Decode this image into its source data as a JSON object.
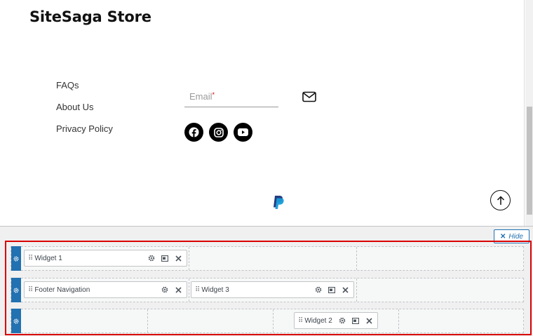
{
  "site": {
    "title": "SiteSaga Store"
  },
  "footer_nav": {
    "links": [
      "FAQs",
      "About Us",
      "Privacy Policy"
    ]
  },
  "newsletter": {
    "email_placeholder": "Email",
    "required_mark": "*"
  },
  "social": {
    "icons": [
      "facebook-icon",
      "instagram-icon",
      "youtube-icon"
    ]
  },
  "builder": {
    "hide_label": "Hide",
    "rows": [
      {
        "widgets": [
          "Widget 1"
        ]
      },
      {
        "widgets": [
          "Footer Navigation",
          "Widget 3"
        ]
      },
      {
        "widgets": [
          "Widget 2"
        ]
      }
    ]
  },
  "colors": {
    "accent": "#2271b1",
    "highlight": "#d90000"
  }
}
